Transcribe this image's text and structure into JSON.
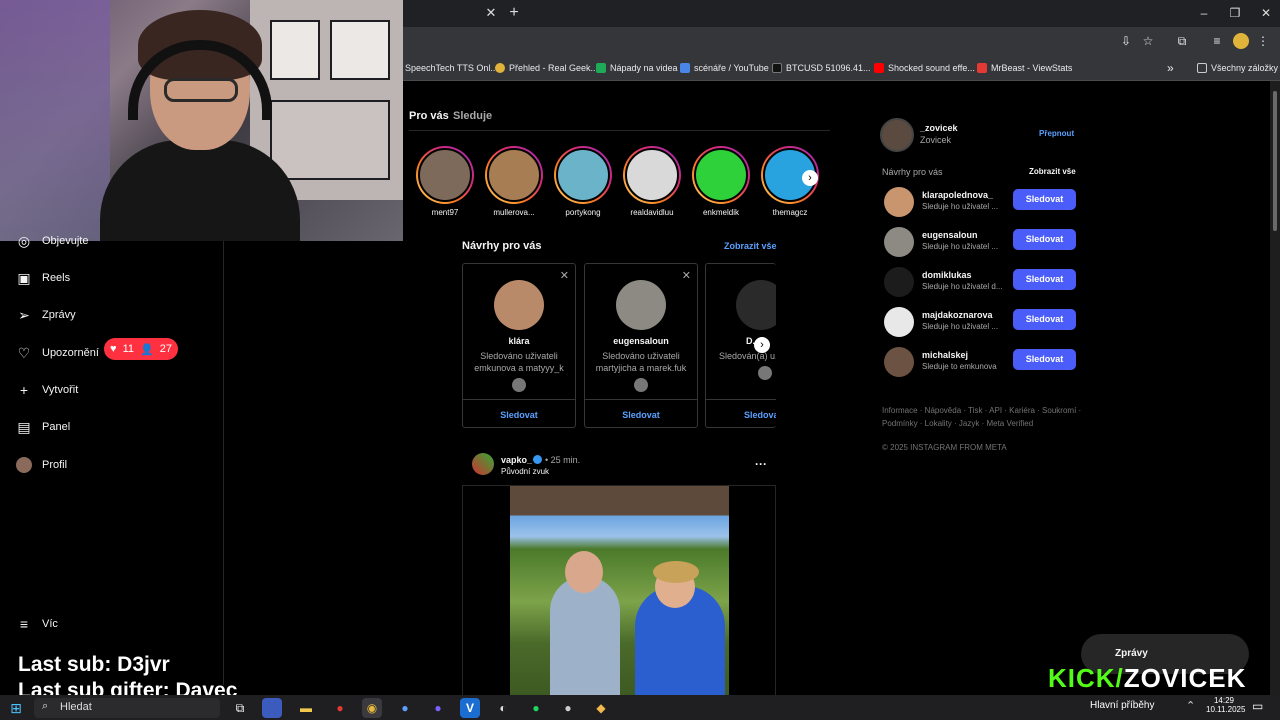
{
  "browser": {
    "bookmarks": [
      {
        "label": "SpeechTech TTS Onl...",
        "color": "#3d6fd8"
      },
      {
        "label": "Přehled - Real Geek...",
        "color": "#e2b23a"
      },
      {
        "label": "Nápady na videa",
        "color": "#1faa59"
      },
      {
        "label": "scénáře / YouTube",
        "color": "#4a86e8"
      },
      {
        "label": "BTCUSD 51096.41...",
        "color": "#111111"
      },
      {
        "label": "Shocked sound effe...",
        "color": "#ff0000"
      },
      {
        "label": "MrBeast - ViewStats",
        "color": "#e53935"
      }
    ],
    "bookmarks_more": "»",
    "all_bookmarks": "Všechny záložky"
  },
  "nav": {
    "items": [
      {
        "label": "Objevujte",
        "icon": "compass-icon"
      },
      {
        "label": "Reels",
        "icon": "reels-icon"
      },
      {
        "label": "Zprávy",
        "icon": "messages-icon"
      },
      {
        "label": "Upozornění",
        "icon": "heart-icon"
      },
      {
        "label": "Vytvořit",
        "icon": "plus-icon"
      },
      {
        "label": "Panel",
        "icon": "panel-icon"
      },
      {
        "label": "Profil",
        "icon": "avatar"
      }
    ],
    "more": "Víc",
    "notif_likes": "11",
    "notif_follows": "27"
  },
  "overlay": {
    "last_sub": "Last sub: D3jvr",
    "last_gifter": "Last sub gifter: Davec",
    "kick_prefix": "KICK/",
    "kick_name": "ZOVICEK"
  },
  "feed": {
    "tab_foryou": "Pro vás",
    "tab_following": "Sleduje",
    "stories": [
      {
        "name": "ment97",
        "color": "#7d6a5a"
      },
      {
        "name": "mullerova...",
        "color": "#a77d54"
      },
      {
        "name": "portykong",
        "color": "#6bb3c9"
      },
      {
        "name": "realdavidluu",
        "color": "#d9d9d9"
      },
      {
        "name": "enkmeldik",
        "color": "#2fd13b"
      },
      {
        "name": "themagcz",
        "color": "#29a3e0"
      }
    ],
    "suggestions_title": "Návrhy pro vás",
    "show_all": "Zobrazit vše",
    "cards": [
      {
        "name": "klára",
        "sub": "Sledováno uživateli emkunova a matyyy_k",
        "follow": "Sledovat",
        "color": "#b98a6a"
      },
      {
        "name": "eugensaloun",
        "sub": "Sledováno uživateli martyjicha a marek.fuk",
        "follow": "Sledovat",
        "color": "#8c8a82"
      },
      {
        "name": "D...k",
        "sub": "Sledován(a) u... dangresla...",
        "follow": "Sledovat",
        "color": "#2a2a2a"
      }
    ],
    "post": {
      "user": "vapko_",
      "time": "• 25 min.",
      "audio": "Původní zvuk",
      "more": "···"
    }
  },
  "right": {
    "username": "_zovicek",
    "fullname": "Zovicek",
    "switch": "Přepnout",
    "suggest_title": "Návrhy pro vás",
    "show_all": "Zobrazit vše",
    "rows": [
      {
        "name": "klarapolednova_",
        "sub": "Sleduje ho uživatel ...",
        "btn": "Sledovat",
        "color": "#c8956f"
      },
      {
        "name": "eugensaloun",
        "sub": "Sleduje ho uživatel ...",
        "btn": "Sledovat",
        "color": "#8d8a84"
      },
      {
        "name": "domiklukas",
        "sub": "Sleduje ho uživatel d...",
        "btn": "Sledovat",
        "color": "#1c1c1c"
      },
      {
        "name": "majdakoznarova",
        "sub": "Sleduje ho uživatel ...",
        "btn": "Sledovat",
        "color": "#e8e8e8"
      },
      {
        "name": "michalskej",
        "sub": "Sleduje to emkunova",
        "btn": "Sledovat",
        "color": "#6b5242"
      }
    ],
    "footer1": "Informace · Nápověda · Tisk · API · Kariéra · Soukromí ·",
    "footer2": "Podmínky · Lokality · Jazyk · Meta Verified",
    "copyright": "© 2025 INSTAGRAM FROM META"
  },
  "taskbar": {
    "search": "Hledat",
    "news": "Hlavní příběhy",
    "time": "14:29",
    "date": "10.11.2025"
  },
  "messages_popup": "Zprávy"
}
